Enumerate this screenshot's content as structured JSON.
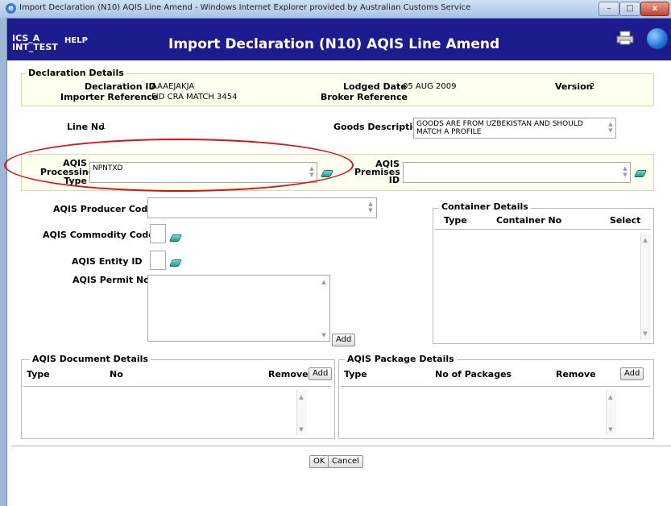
{
  "window": {
    "title": "Import Declaration (N10) AQIS Line Amend - Windows Internet Explorer provided by Australian Customs Service"
  },
  "header": {
    "system_line1": "ICS_A",
    "system_line2": "INT_TEST",
    "help": "HELP",
    "title": "Import Declaration (N10) AQIS Line Amend"
  },
  "declaration": {
    "legend": "Declaration Details",
    "id_label": "Declaration ID",
    "id_value": "AAAEJAKJA",
    "lodged_label": "Lodged Date",
    "lodged_value": "05 AUG 2009",
    "version_label": "Version",
    "version_value": "2",
    "importer_label": "Importer Reference",
    "importer_value": "FID CRA MATCH 3454",
    "broker_label": "Broker Reference",
    "broker_value": ""
  },
  "line": {
    "line_no_label": "Line No",
    "line_no_value": "1",
    "goods_label": "Goods Description",
    "goods_value": "GOODS ARE FROM UZBEKISTAN AND SHOULD MATCH A PROFILE"
  },
  "aqis": {
    "processing_label_1": "AQIS",
    "processing_label_2": "Processing",
    "processing_label_3": "Type",
    "processing_value": "NPNTXD",
    "premises_label_1": "AQIS",
    "premises_label_2": "Premises",
    "premises_label_3": "ID",
    "premises_value": "",
    "producer_label": "AQIS Producer Code",
    "producer_value": "",
    "commodity_label": "AQIS Commodity Code",
    "commodity_value": "",
    "entity_label": "AQIS Entity ID",
    "entity_value": "",
    "permit_label": "AQIS Permit No",
    "permit_value": "",
    "add": "Add"
  },
  "container": {
    "legend": "Container Details",
    "col_type": "Type",
    "col_no": "Container No",
    "col_select": "Select"
  },
  "document": {
    "legend": "AQIS Document Details",
    "col_type": "Type",
    "col_no": "No",
    "col_remove": "Remove",
    "add": "Add"
  },
  "package": {
    "legend": "AQIS Package Details",
    "col_type": "Type",
    "col_no": "No of Packages",
    "col_remove": "Remove",
    "add": "Add"
  },
  "footer": {
    "ok": "OK",
    "cancel": "Cancel"
  }
}
